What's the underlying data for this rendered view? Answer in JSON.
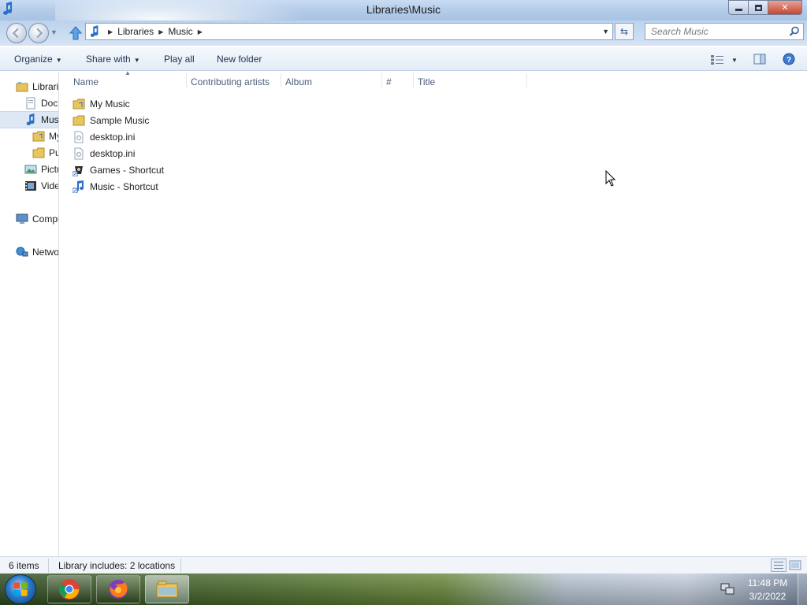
{
  "window": {
    "title": "Libraries\\Music",
    "controls": {
      "minimize_icon": "minimize-icon",
      "maximize_icon": "restore-icon",
      "close_label": "✕"
    }
  },
  "address": {
    "breadcrumb": [
      "Libraries",
      "Music"
    ],
    "search_placeholder": "Search Music"
  },
  "toolbar": {
    "organize": "Organize",
    "share_with": "Share with",
    "play_all": "Play all",
    "new_folder": "New folder"
  },
  "navpane": {
    "items": [
      {
        "label": "Libraries",
        "icon": "libraries-icon"
      },
      {
        "label": "Documents",
        "icon": "documents-icon"
      },
      {
        "label": "Music",
        "icon": "music-library-icon"
      },
      {
        "label": "My Music",
        "icon": "folder-icon"
      },
      {
        "label": "Public Music",
        "icon": "folder-icon"
      },
      {
        "label": "Pictures",
        "icon": "pictures-icon"
      },
      {
        "label": "Videos",
        "icon": "videos-icon"
      },
      {
        "label": "Computer",
        "icon": "computer-icon"
      },
      {
        "label": "Network",
        "icon": "network-icon"
      }
    ]
  },
  "columns": [
    "Name",
    "Contributing artists",
    "Album",
    "#",
    "Title"
  ],
  "files": [
    {
      "name": "My Music",
      "icon": "folder-icon"
    },
    {
      "name": "Sample Music",
      "icon": "folder-icon"
    },
    {
      "name": "desktop.ini",
      "icon": "settings-file-icon"
    },
    {
      "name": "desktop.ini",
      "icon": "settings-file-icon"
    },
    {
      "name": "Games - Shortcut",
      "icon": "games-shortcut-icon"
    },
    {
      "name": "Music - Shortcut",
      "icon": "music-shortcut-icon"
    }
  ],
  "status": {
    "item_count": "6 items",
    "locations": "Library includes: 2 locations"
  },
  "taskbar": {
    "apps": [
      "Google Chrome",
      "Firefox",
      "Windows Explorer"
    ],
    "time": "11:48 PM",
    "date": "3/2/2022"
  },
  "colors": {
    "selection": "#dde8f4",
    "toolbar_text": "#1e3250",
    "column_header_text": "#4c607a"
  }
}
